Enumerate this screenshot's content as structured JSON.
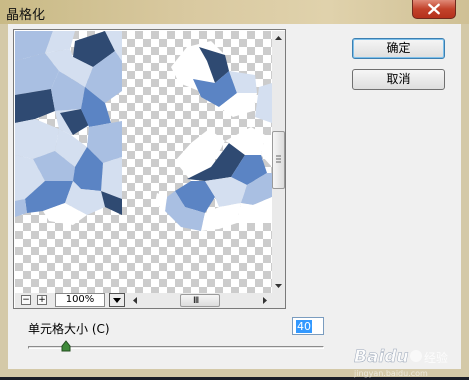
{
  "window": {
    "title": "晶格化",
    "close_icon": "close-icon"
  },
  "preview": {
    "zoom_out_label": "−",
    "zoom_in_label": "+",
    "zoom_value": "100%",
    "scroll_grip": "Ⅲ"
  },
  "buttons": {
    "ok_label": "确定",
    "cancel_label": "取消"
  },
  "parameter": {
    "label": "单元格大小 (C)",
    "value": "40",
    "slider_level": 0.13
  },
  "watermark": {
    "text": "Baidu",
    "subtext": "经验"
  },
  "colors": {
    "dark_blue": "#2f4a72",
    "mid_blue": "#5b84c4",
    "light_blue": "#a9bfe2",
    "pale_blue": "#d4dff0",
    "selection": "#3399ff"
  }
}
